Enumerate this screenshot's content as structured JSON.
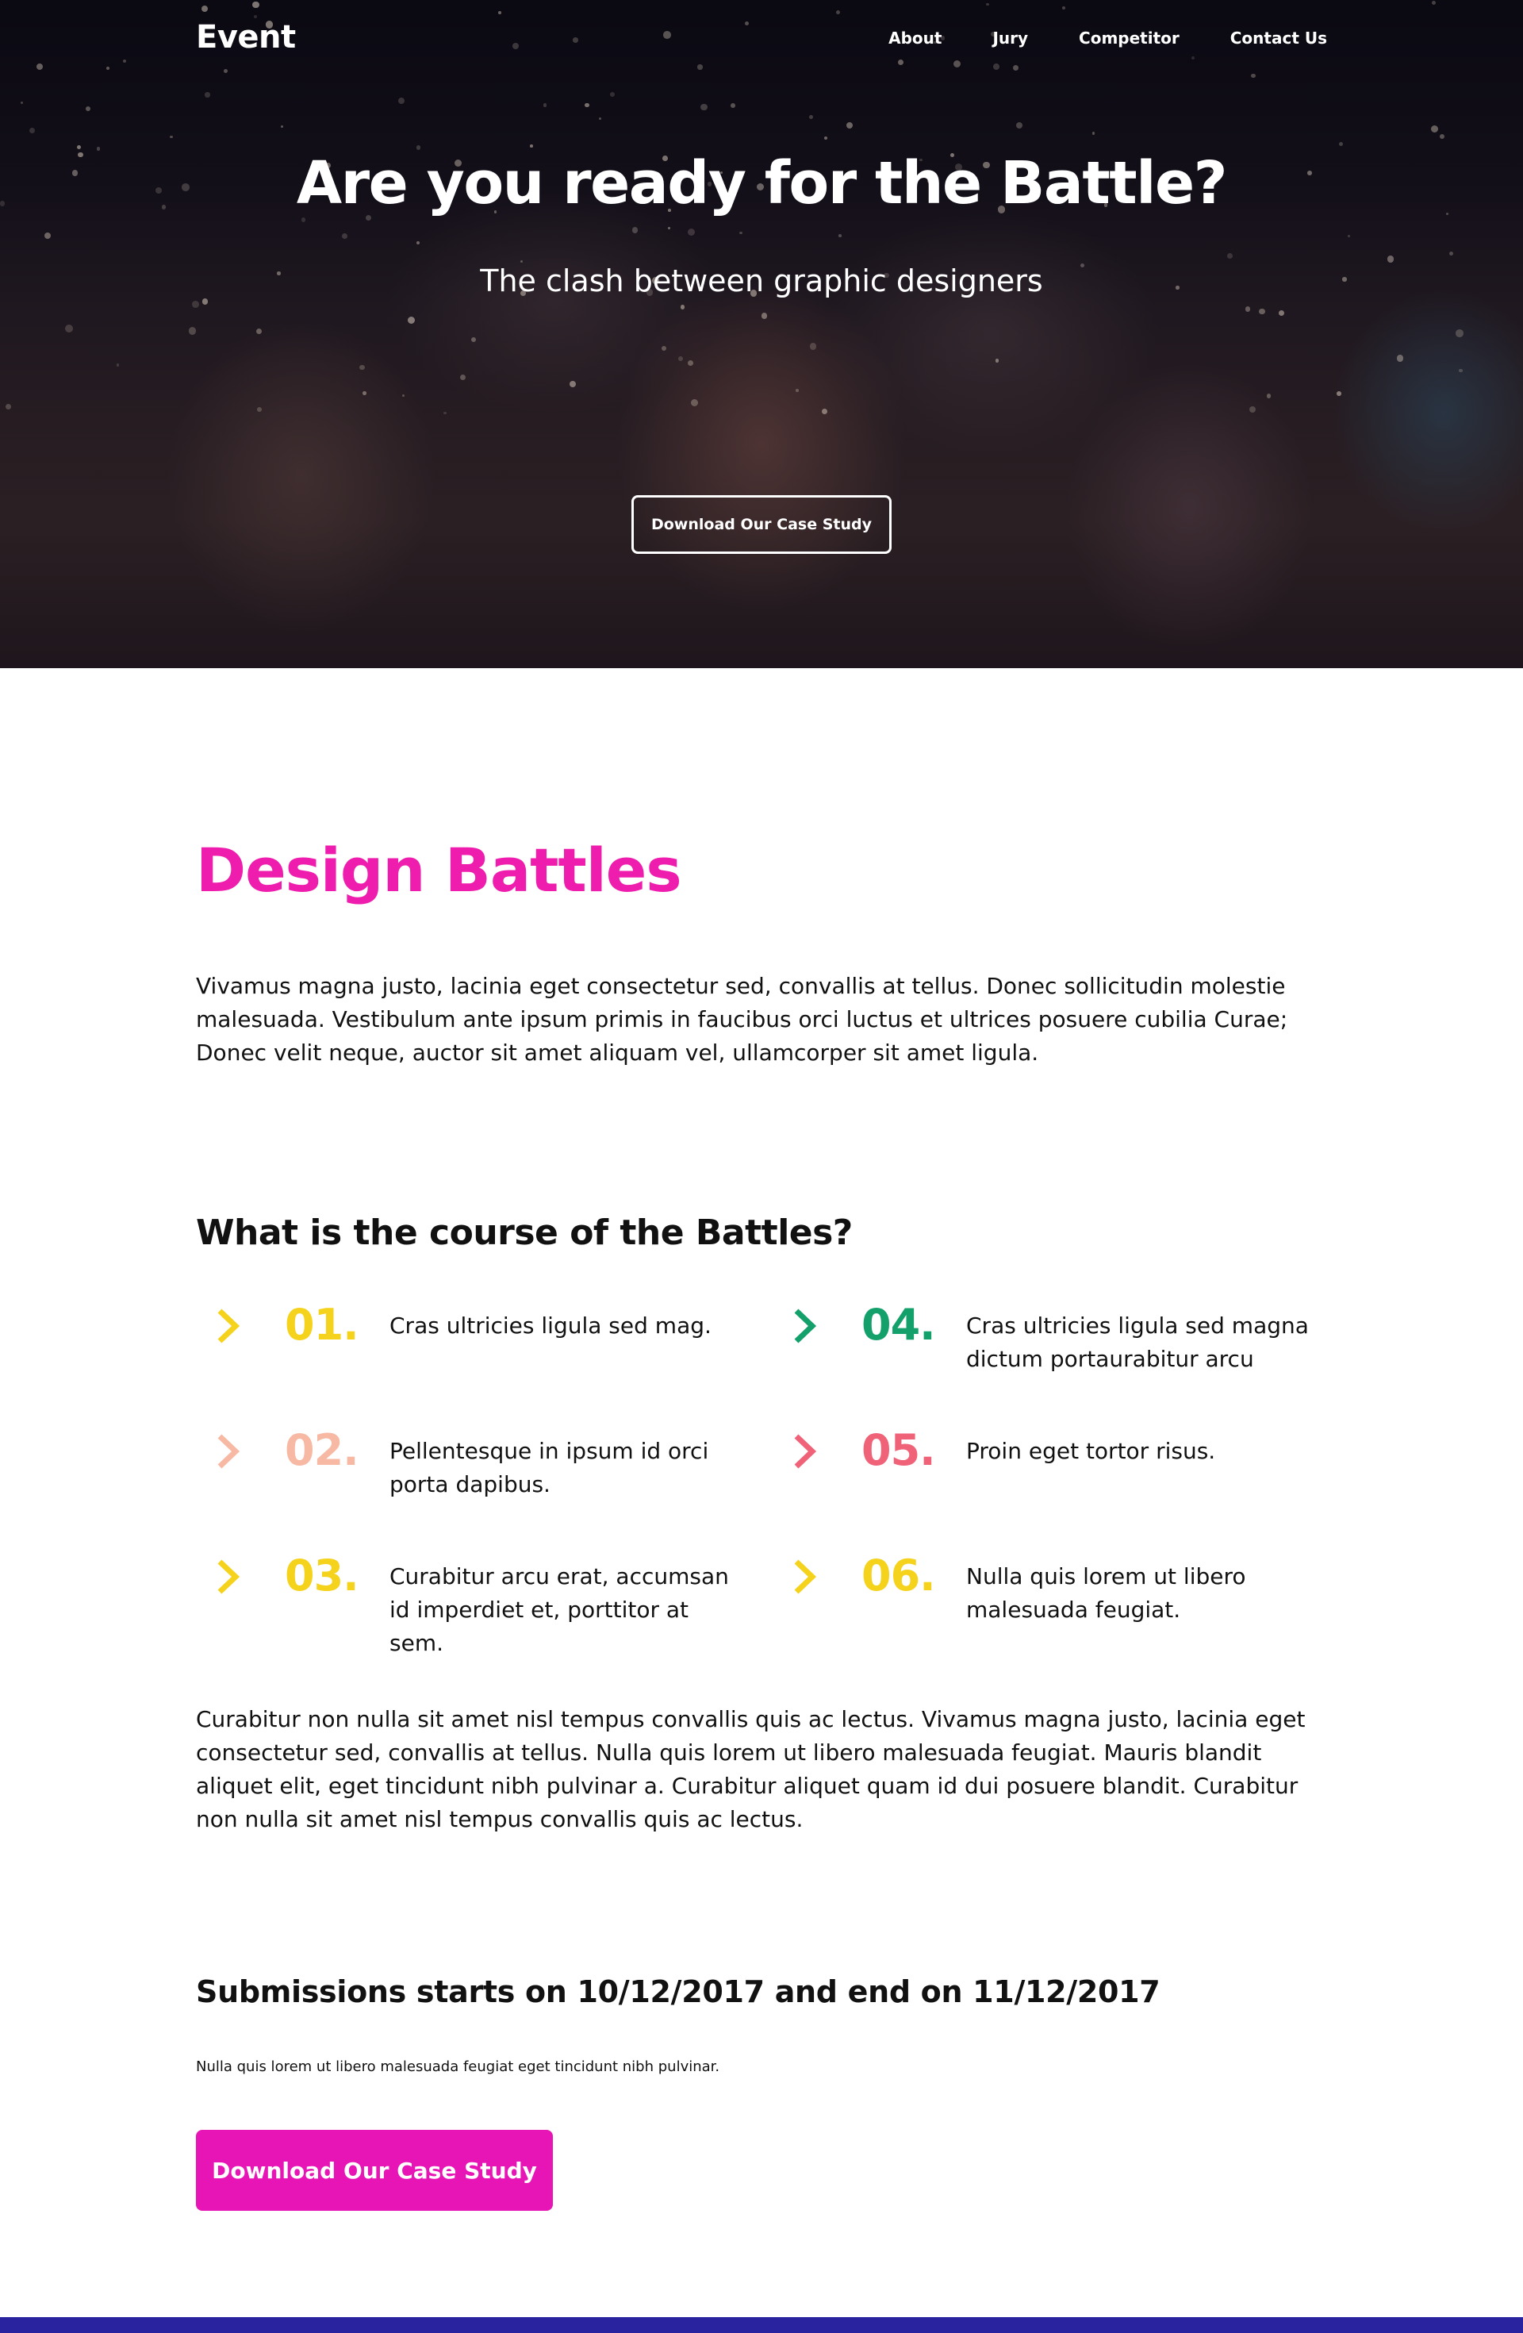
{
  "header": {
    "brand": "Event",
    "nav": [
      "About",
      "Jury",
      "Competitor",
      "Contact Us"
    ]
  },
  "hero": {
    "title": "Are you ready for the Battle?",
    "subtitle": "The clash between graphic designers",
    "button_label": "Download Our Case Study"
  },
  "main": {
    "title": "Design Battles",
    "intro": "Vivamus magna justo, lacinia eget consectetur sed, convallis at tellus. Donec sollicitudin molestie malesuada. Vestibulum ante ipsum primis in faucibus orci luctus et ultrices posuere cubilia Curae; Donec velit neque, auctor sit amet aliquam vel, ullamcorper sit amet ligula.",
    "course_title": "What is the course of the Battles?",
    "steps": [
      {
        "number": "01.",
        "text": "Cras ultricies ligula sed mag.",
        "color": "#f5d21b"
      },
      {
        "number": "02.",
        "text": "Pellentesque in ipsum id orci porta dapibus.",
        "color": "#f7b9a3"
      },
      {
        "number": "03.",
        "text": "Curabitur arcu erat, accumsan id imperdiet et, porttitor at sem.",
        "color": "#f5d21b"
      },
      {
        "number": "04.",
        "text": "Cras ultricies ligula sed magna dictum portaurabitur arcu",
        "color": "#14a06b"
      },
      {
        "number": "05.",
        "text": "Proin eget tortor risus.",
        "color": "#ef6277"
      },
      {
        "number": "06.",
        "text": "Nulla quis lorem ut libero malesuada feugiat.",
        "color": "#f5d21b"
      }
    ],
    "paragraph": "Curabitur non nulla sit amet nisl tempus convallis quis ac lectus. Vivamus magna justo, lacinia eget consectetur sed, convallis at tellus. Nulla quis lorem ut libero malesuada feugiat. Mauris blandit aliquet elit, eget tincidunt nibh pulvinar a. Curabitur aliquet quam id dui posuere blandit. Curabitur non nulla sit amet nisl tempus convallis quis ac lectus.",
    "submissions_title": "Submissions starts on 10/12/2017 and end on 11/12/2017",
    "note": "Nulla quis lorem ut libero malesuada feugiat eget tincidunt nibh pulvinar.",
    "cta_label": "Download Our Case Study"
  },
  "colors": {
    "accent": "#ef1dad",
    "cta": "#e815b6",
    "footer": "#2a23a0"
  },
  "icons": {
    "step": "chevron-right-icon"
  }
}
